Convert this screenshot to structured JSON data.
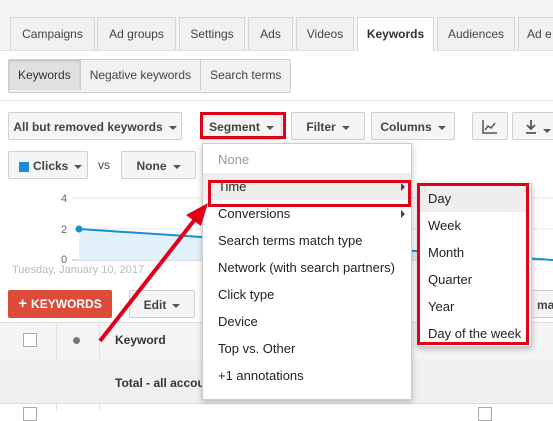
{
  "tabs": [
    "Campaigns",
    "Ad groups",
    "Settings",
    "Ads",
    "Videos",
    "Keywords",
    "Audiences",
    "Ad e"
  ],
  "subtabs": [
    "Keywords",
    "Negative keywords",
    "Search terms"
  ],
  "toolbar": {
    "filter_view": "All but removed keywords",
    "segment": "Segment",
    "filter": "Filter",
    "columns": "Columns"
  },
  "chart": {
    "metric1": "Clicks",
    "vs": "vs",
    "metric2": "None",
    "y_ticks": [
      "4",
      "2",
      "0"
    ],
    "date_label": "Tuesday, January 10, 2017",
    "line_color": "#1a8fd6"
  },
  "chart_data": {
    "type": "line",
    "series": [
      {
        "values": [
          2,
          0
        ]
      }
    ],
    "yticks": [
      4,
      2,
      0
    ],
    "ylim": [
      0,
      4
    ]
  },
  "actions": {
    "keywords_button": "KEYWORDS",
    "edit_button": "Edit",
    "right_cut": "ma"
  },
  "table": {
    "col_keyword": "Keyword",
    "total_row": "Total - all accou"
  },
  "segment_menu": {
    "items": [
      {
        "label": "None",
        "muted": true
      },
      {
        "label": "Time",
        "has_sub": true
      },
      {
        "label": "Conversions",
        "has_sub": true
      },
      {
        "label": "Search terms match type"
      },
      {
        "label": "Network (with search partners)"
      },
      {
        "label": "Click type"
      },
      {
        "label": "Device"
      },
      {
        "label": "Top vs. Other"
      },
      {
        "label": "+1 annotations"
      }
    ]
  },
  "time_submenu": {
    "items": [
      "Day",
      "Week",
      "Month",
      "Quarter",
      "Year",
      "Day of the week"
    ]
  },
  "colors": {
    "accent_red": "#e0001a",
    "keywords_button": "#dd4b39",
    "clicks_swatch": "#1a8fd6"
  }
}
